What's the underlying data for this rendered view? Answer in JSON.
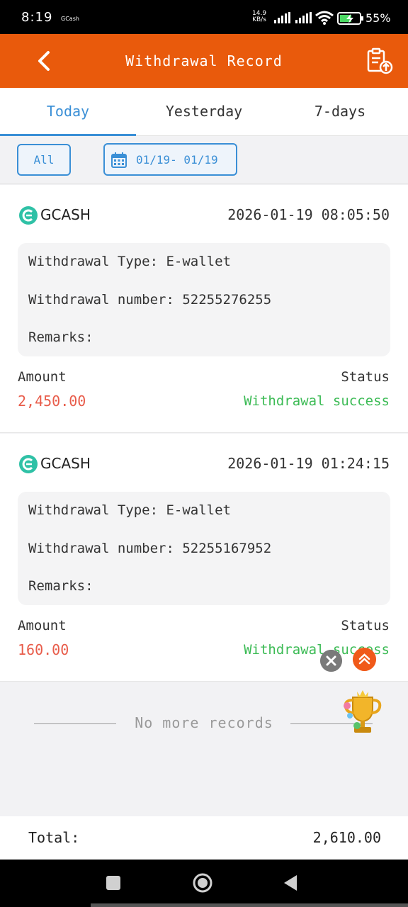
{
  "status_bar": {
    "time": "8:19",
    "app_label": "GCash",
    "net_speed_value": "14.9",
    "net_speed_unit": "KB/s",
    "battery": "55%"
  },
  "header": {
    "title": "Withdrawal Record",
    "back_icon": "chevron-left-icon",
    "export_icon": "clipboard-upload-icon",
    "color": "#e95a0c"
  },
  "tabs": [
    {
      "label": "Today",
      "active": true
    },
    {
      "label": "Yesterday",
      "active": false
    },
    {
      "label": "7-days",
      "active": false
    }
  ],
  "filter": {
    "type_label": "All",
    "date_range": "01/19- 01/19"
  },
  "records": [
    {
      "channel": "GCASH",
      "datetime": "2026-01-19 08:05:50",
      "type_line": "Withdrawal Type: E-wallet",
      "number_line": "Withdrawal number: 52255276255",
      "remarks_line": "Remarks:",
      "amount_label": "Amount",
      "status_label": "Status",
      "amount": "2,450.00",
      "status": "Withdrawal success"
    },
    {
      "channel": "GCASH",
      "datetime": "2026-01-19 01:24:15",
      "type_line": "Withdrawal Type: E-wallet",
      "number_line": "Withdrawal number: 52255167952",
      "remarks_line": "Remarks:",
      "amount_label": "Amount",
      "status_label": "Status",
      "amount": "160.00",
      "status": "Withdrawal success"
    }
  ],
  "no_more": "No more records",
  "total": {
    "label": "Total:",
    "value": "2,610.00"
  },
  "colors": {
    "accent": "#3a8fd6",
    "amount": "#e85c4a",
    "success": "#3cbb55"
  }
}
